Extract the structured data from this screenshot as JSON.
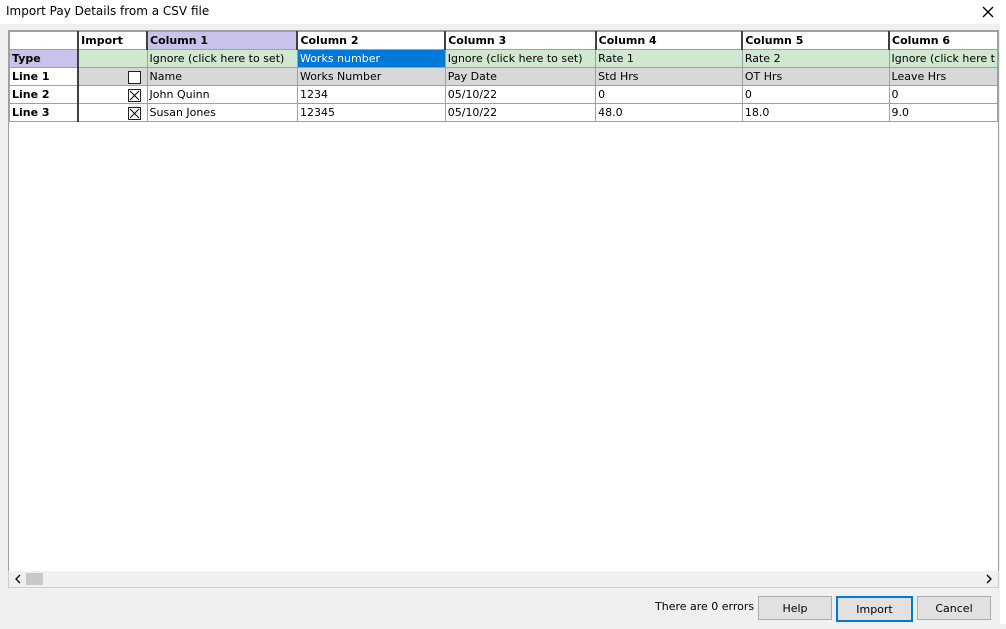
{
  "window": {
    "title": "Import Pay Details from a CSV file",
    "close_glyph": "✕"
  },
  "grid": {
    "import_header": "Import",
    "columns": [
      "Column 1",
      "Column 2",
      "Column 3",
      "Column 4",
      "Column 5",
      "Column 6"
    ],
    "selected_column_index": 0,
    "type_row": {
      "label": "Type",
      "values": [
        "Ignore (click here to set)",
        "Works number",
        "Ignore (click here to set)",
        "Rate 1",
        "Rate 2",
        "Ignore (click here t"
      ],
      "selected_index": 1
    },
    "rows": [
      {
        "label": "Line 1",
        "checked": false,
        "cells": [
          "Name",
          "Works Number",
          "Pay Date",
          "Std Hrs",
          "OT Hrs",
          "Leave Hrs"
        ]
      },
      {
        "label": "Line 2",
        "checked": true,
        "cells": [
          "John Quinn",
          "1234",
          "05/10/22",
          "0",
          "0",
          "0"
        ]
      },
      {
        "label": "Line 3",
        "checked": true,
        "cells": [
          "Susan Jones",
          "12345",
          "05/10/22",
          "48.0",
          "18.0",
          "9.0"
        ]
      }
    ]
  },
  "scrollbar": {
    "left_arrow": "<",
    "right_arrow": ">"
  },
  "footer": {
    "status": "There are 0 errors",
    "help_label": "Help",
    "import_label": "Import",
    "cancel_label": "Cancel"
  },
  "icons": {
    "close": "close-icon",
    "checkbox": "checkbox-icon",
    "scroll_left": "chevron-left-icon",
    "scroll_right": "chevron-right-icon"
  }
}
